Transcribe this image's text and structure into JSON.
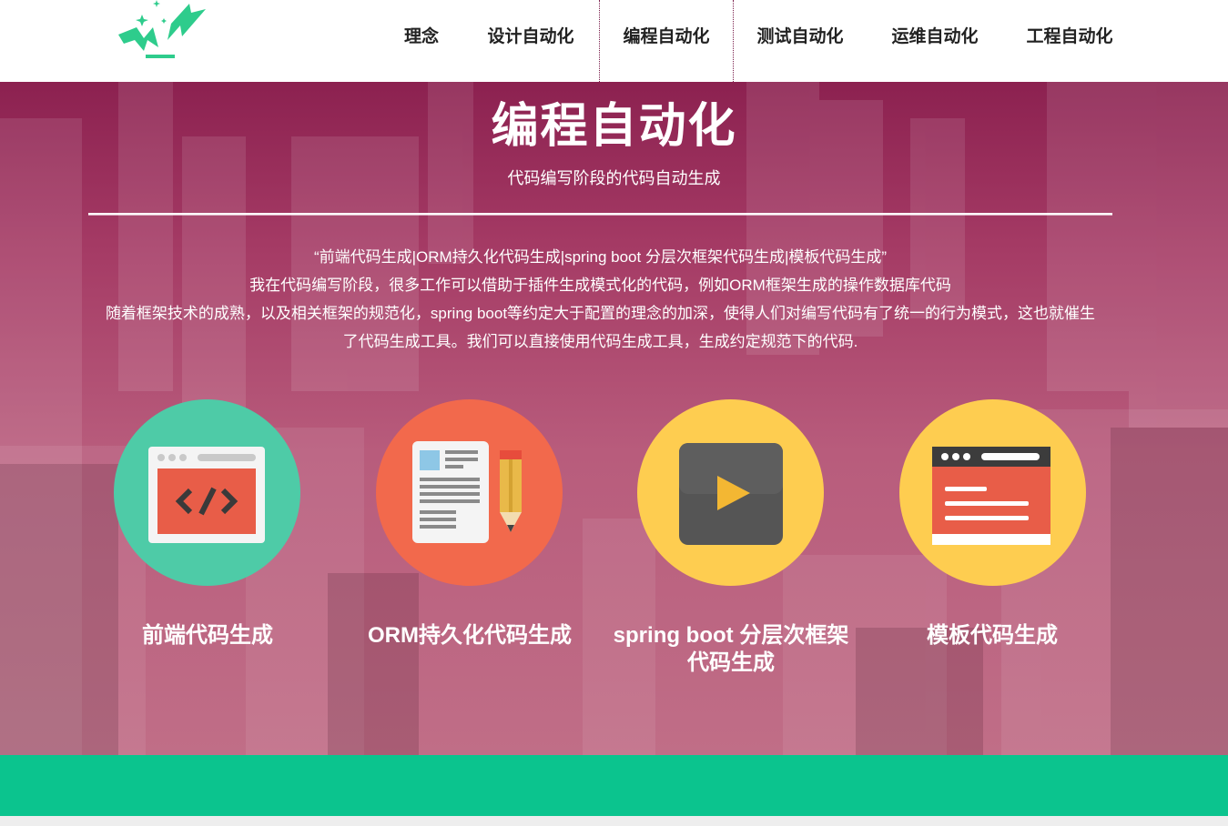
{
  "header": {
    "nav": [
      {
        "label": "理念"
      },
      {
        "label": "设计自动化"
      },
      {
        "label": "编程自动化",
        "active": true
      },
      {
        "label": "测试自动化"
      },
      {
        "label": "运维自动化"
      },
      {
        "label": "工程自动化"
      }
    ]
  },
  "hero": {
    "title": "编程自动化",
    "subtitle": "代码编写阶段的代码自动生成",
    "intro_lines": [
      "“前端代码生成|ORM持久化代码生成|spring boot 分层次框架代码生成|模板代码生成”",
      "我在代码编写阶段，很多工作可以借助于插件生成模式化的代码，例如ORM框架生成的操作数据库代码",
      "随着框架技术的成熟，以及相关框架的规范化，spring boot等约定大于配置的理念的加深，使得人们对编写代码有了统一的行为模式，这也就催生",
      "了代码生成工具。我们可以直接使用代码生成工具，生成约定规范下的代码."
    ]
  },
  "features": [
    {
      "label": "前端代码生成",
      "icon": "code-window-icon",
      "color": "#4ecba7"
    },
    {
      "label": "ORM持久化代码生成",
      "icon": "document-pencil-icon",
      "color": "#f2694c"
    },
    {
      "label": "spring boot 分层次框架代码生成",
      "icon": "play-button-icon",
      "color": "#fecd50"
    },
    {
      "label": "模板代码生成",
      "icon": "template-window-icon",
      "color": "#fecd50"
    }
  ],
  "colors": {
    "brand_green": "#0bc48e",
    "hero_overlay": "#a53b65",
    "logo_green": "#2ecc8c"
  }
}
